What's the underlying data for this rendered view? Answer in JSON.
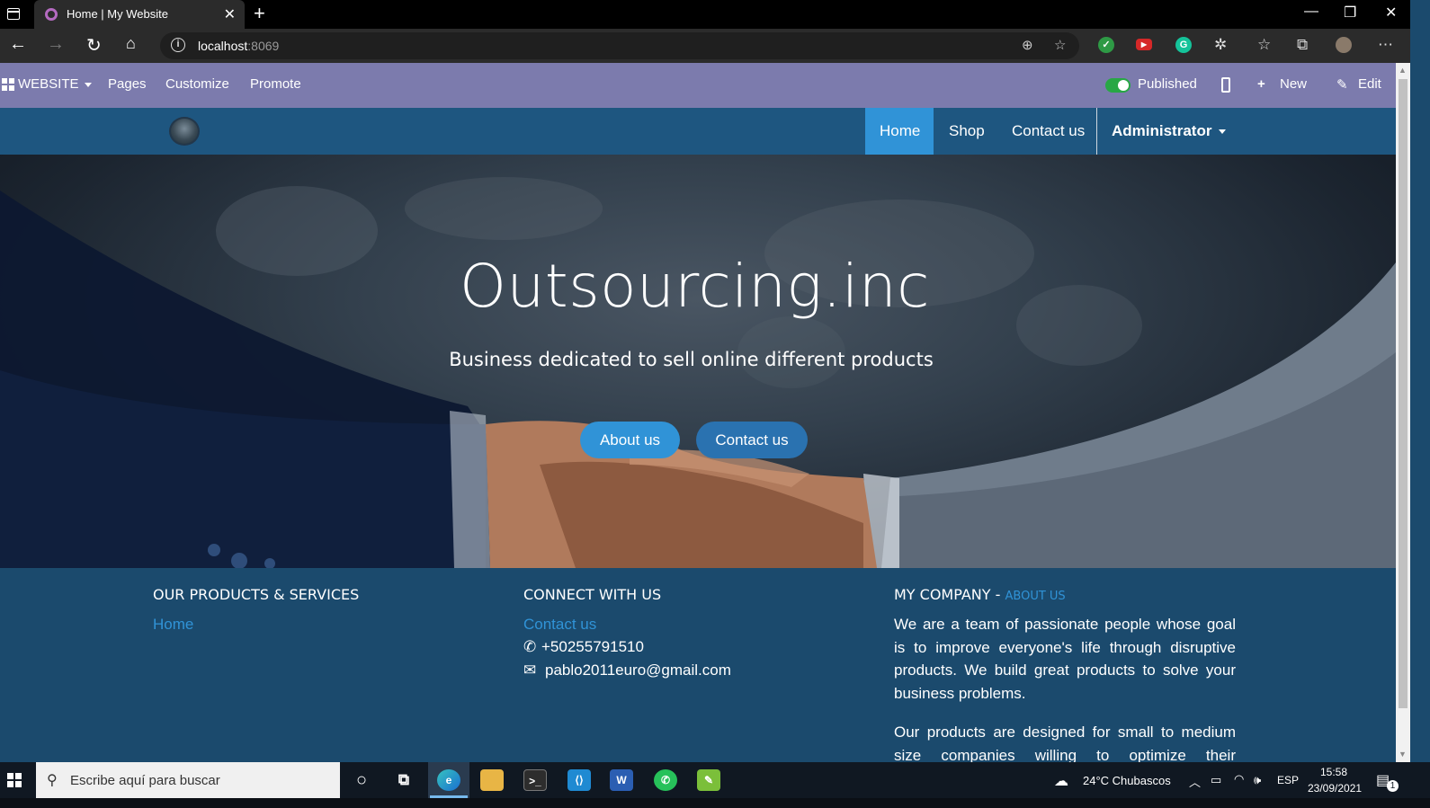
{
  "browser": {
    "tab_title": "Home | My Website",
    "new_tab_symbol": "+",
    "close_symbol": "✕",
    "url_host": "localhost",
    "url_port": ":8069",
    "window_controls": [
      "—",
      "❐",
      "✕"
    ]
  },
  "admin_bar": {
    "app_menu": "WEBSITE",
    "pages": "Pages",
    "customize": "Customize",
    "promote": "Promote",
    "published": "Published",
    "new": "New",
    "edit": "Edit"
  },
  "site_nav": {
    "items": [
      {
        "label": "Home",
        "active": true
      },
      {
        "label": "Shop",
        "active": false
      },
      {
        "label": "Contact us",
        "active": false
      }
    ],
    "user": "Administrator"
  },
  "hero": {
    "title": "Outsourcing.inc",
    "subtitle": "Business dedicated to sell online different products",
    "primary_button": "About us",
    "secondary_button": "Contact us"
  },
  "footer": {
    "products": {
      "heading": "OUR PRODUCTS & SERVICES",
      "links": [
        "Home"
      ]
    },
    "connect": {
      "heading": "CONNECT WITH US",
      "contact_link": "Contact us",
      "phone": "+50255791510",
      "email": "pablo2011euro@gmail.com"
    },
    "company": {
      "heading": "MY COMPANY",
      "separator": " - ",
      "about_link": "ABOUT US",
      "paragraph1": "We are a team of passionate people whose goal is to improve everyone's life through disruptive products. We build great products to solve your business problems.",
      "paragraph2": "Our products are designed for small to medium size companies willing to optimize their performance."
    }
  },
  "taskbar": {
    "search_placeholder": "Escribe aquí para buscar",
    "weather": "24°C  Chubascos",
    "language": "ESP",
    "time": "15:58",
    "date": "23/09/2021",
    "notification_count": "1"
  },
  "colors": {
    "admin_bar": "#7c7bad",
    "site_header": "#1e5680",
    "accent": "#3093d7",
    "footer": "#1b4a6d"
  }
}
